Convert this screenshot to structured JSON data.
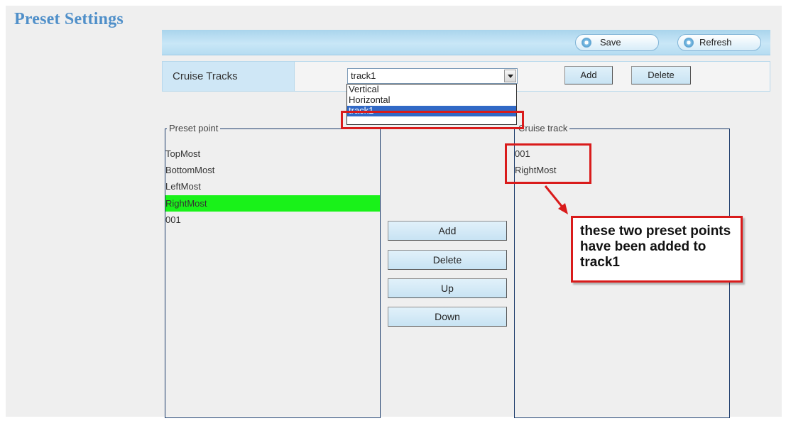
{
  "page": {
    "title": "Preset Settings"
  },
  "toolbar": {
    "save_label": "Save",
    "refresh_label": "Refresh"
  },
  "cruise": {
    "row_label": "Cruise Tracks",
    "selected_track": "track1",
    "track_options": [
      "Vertical",
      "Horizontal",
      "track1"
    ],
    "add_label": "Add",
    "delete_label": "Delete"
  },
  "preset_group": {
    "legend": "Preset point",
    "items": [
      "TopMost",
      "BottomMost",
      "LeftMost",
      "RightMost",
      "001"
    ],
    "selected": "RightMost"
  },
  "cruise_group": {
    "legend": "Cruise track",
    "items": [
      "001",
      "RightMost"
    ]
  },
  "middle_buttons": {
    "add": "Add",
    "delete": "Delete",
    "up": "Up",
    "down": "Down"
  },
  "annotation": {
    "text": "these two preset points have been added to track1"
  },
  "colors": {
    "accent": "#4f8fc9",
    "selection_green": "#19f219",
    "highlight_red": "#d91b1b",
    "selection_blue": "#3169c6"
  }
}
